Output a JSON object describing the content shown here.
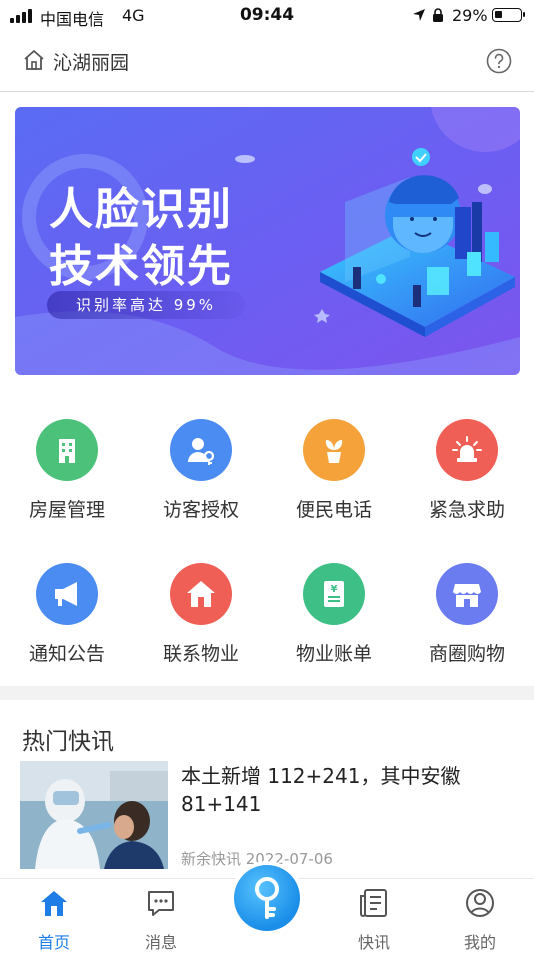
{
  "status_bar": {
    "carrier": "中国电信",
    "network": "4G",
    "time": "09:44",
    "battery": "29%",
    "battery_level": 0.29
  },
  "header": {
    "community_name": "沁湖丽园",
    "home_icon": "home-icon",
    "help_icon": "help-icon"
  },
  "banner": {
    "title_line1": "人脸识别",
    "title_line2": "技术领先",
    "subtitle": "识别率高达 99%"
  },
  "features": [
    {
      "label": "房屋管理",
      "icon": "building-icon",
      "color": "#4cc17a"
    },
    {
      "label": "访客授权",
      "icon": "visitor-key-icon",
      "color": "#4b8cf2"
    },
    {
      "label": "便民电话",
      "icon": "plant-pot-icon",
      "color": "#f5a23a"
    },
    {
      "label": "紧急求助",
      "icon": "alarm-light-icon",
      "color": "#ef5f55"
    },
    {
      "label": "通知公告",
      "icon": "megaphone-icon",
      "color": "#4b8cf2"
    },
    {
      "label": "联系物业",
      "icon": "house-icon",
      "color": "#ef5f55"
    },
    {
      "label": "物业账单",
      "icon": "bill-icon",
      "color": "#3dbf86"
    },
    {
      "label": "商圈购物",
      "icon": "shop-icon",
      "color": "#6a7cf0"
    }
  ],
  "news": {
    "section_title": "热门快讯",
    "items": [
      {
        "headline": "本土新增 112+241，其中安徽81+141",
        "source_date": "新余快讯 2022-07-06"
      }
    ]
  },
  "tabbar": {
    "tabs": [
      {
        "label": "首页",
        "icon": "home-icon",
        "active": true
      },
      {
        "label": "消息",
        "icon": "message-icon",
        "active": false
      },
      {
        "label": "快讯",
        "icon": "news-icon",
        "active": false
      },
      {
        "label": "我的",
        "icon": "profile-icon",
        "active": false
      }
    ],
    "center_icon": "key-icon",
    "active_color": "#1e7de6"
  }
}
